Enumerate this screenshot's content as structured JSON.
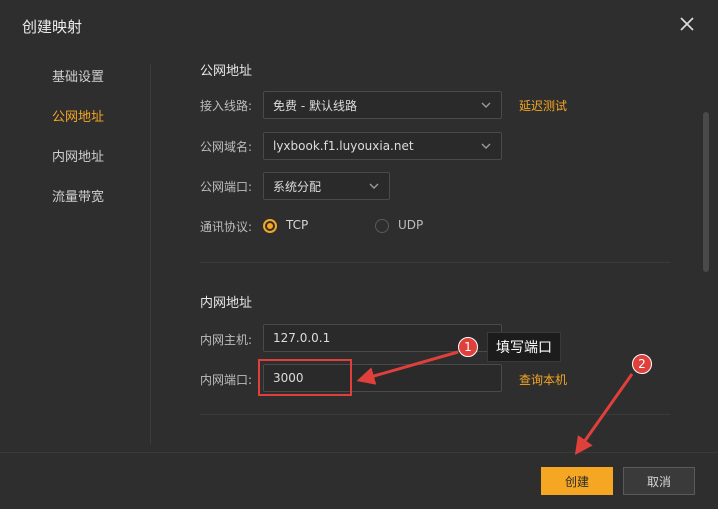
{
  "dialog": {
    "title": "创建映射"
  },
  "sidebar": {
    "items": [
      {
        "label": "基础设置"
      },
      {
        "label": "公网地址"
      },
      {
        "label": "内网地址"
      },
      {
        "label": "流量带宽"
      }
    ],
    "active_index": 1
  },
  "public": {
    "section_title": "公网地址",
    "line_label": "接入线路:",
    "line_value": "免费 - 默认线路",
    "latency_link": "延迟测试",
    "domain_label": "公网域名:",
    "domain_value": "lyxbook.f1.luyouxia.net",
    "port_label": "公网端口:",
    "port_value": "系统分配",
    "protocol_label": "通讯协议:",
    "protocol_options": [
      "TCP",
      "UDP"
    ],
    "protocol_selected": "TCP"
  },
  "internal": {
    "section_title": "内网地址",
    "host_label": "内网主机:",
    "host_value": "127.0.0.1",
    "port_label": "内网端口:",
    "port_value": "3000",
    "query_link": "查询本机"
  },
  "annotations": {
    "callout_text": "填写端口",
    "badge_1": "1",
    "badge_2": "2"
  },
  "footer": {
    "create_label": "创建",
    "cancel_label": "取消"
  },
  "colors": {
    "accent": "#f5a623",
    "annotation": "#e0403c",
    "background": "#2e2e2e"
  }
}
